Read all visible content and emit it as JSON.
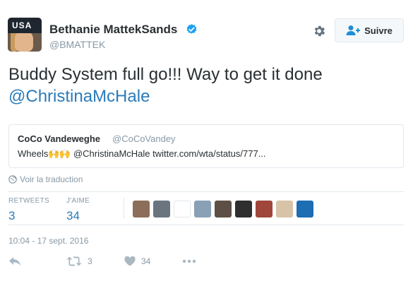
{
  "author": {
    "name": "Bethanie MattekSands",
    "handle": "@BMATTEK",
    "avatar_cap_text": "USA",
    "verified": true
  },
  "header": {
    "follow_label": "Suivre",
    "gear_icon": "gear-icon",
    "follow_icon": "add-user-icon"
  },
  "tweet": {
    "text": "Buddy System full go!!! Way to get it done",
    "mention": "@ChristinaMcHale"
  },
  "quote": {
    "name": "CoCo Vandeweghe",
    "handle": "@CoCoVandey",
    "text_prefix": "Wheels",
    "emoji": "🙌🙌",
    "text_suffix": " @ChristinaMcHale twitter.com/wta/status/777..."
  },
  "translate_label": "Voir la traduction",
  "stats": {
    "retweets_label": "RETWEETS",
    "retweets_value": "3",
    "likes_label": "J'AIME",
    "likes_value": "34"
  },
  "likers": [
    {
      "color": "#8d6e5a"
    },
    {
      "color": "#6a7580"
    },
    {
      "color": "#ffffff"
    },
    {
      "color": "#8aa0b4"
    },
    {
      "color": "#5d4f46"
    },
    {
      "color": "#2f2f2f"
    },
    {
      "color": "#a0463a"
    },
    {
      "color": "#d7c3a8"
    },
    {
      "color": "#1d6db2"
    }
  ],
  "timestamp": "10:04 - 17 sept. 2016",
  "actions": {
    "reply_icon": "reply-icon",
    "retweet_icon": "retweet-icon",
    "retweet_count": "3",
    "like_icon": "heart-icon",
    "like_count": "34",
    "more_icon": "more-icon"
  },
  "colors": {
    "accent": "#2b7bb9",
    "muted": "#8899a6",
    "verified": "#1da1f2"
  }
}
